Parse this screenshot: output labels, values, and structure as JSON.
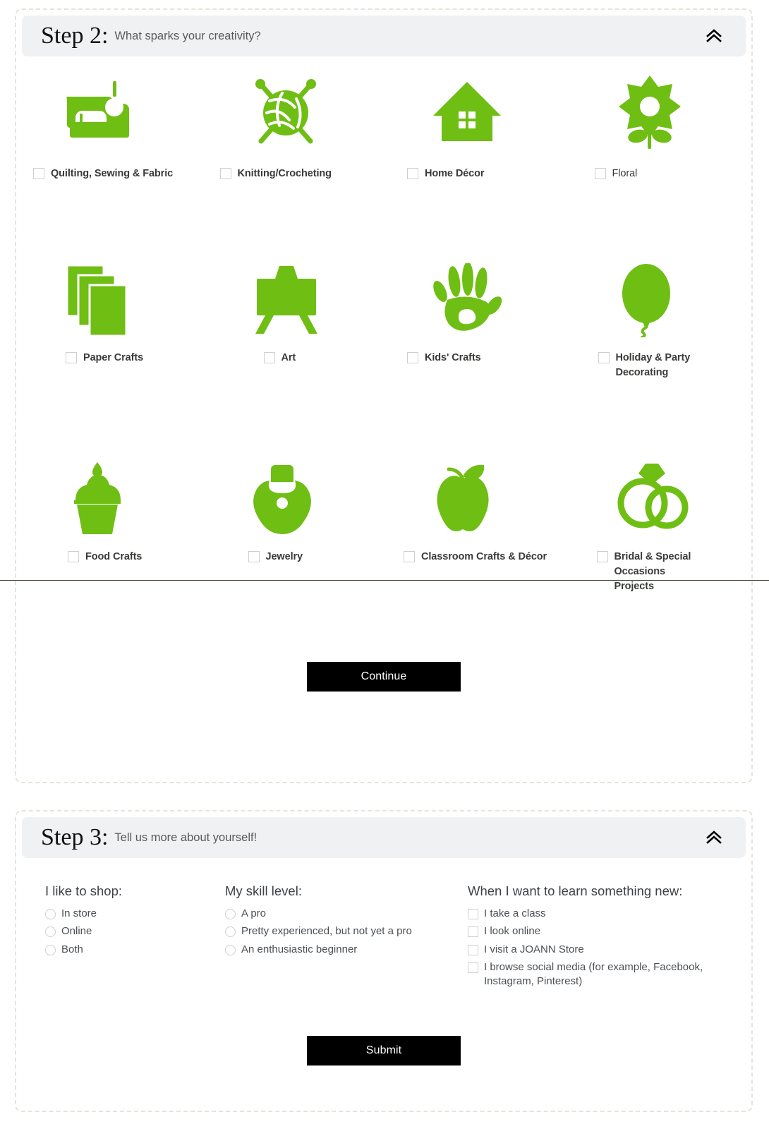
{
  "theme": {
    "icon_green": "#6FBE13",
    "header_bg": "#F0F1F2",
    "panel_border": "#E8E3D9",
    "button_bg": "#000000",
    "button_text": "#FFFFFF",
    "label_color": "#3A3A38",
    "seam_color": "#3F4F38"
  },
  "step2": {
    "title": "Step 2:",
    "subtitle": "What sparks your creativity?",
    "collapse_icon": "double-chevron-up-icon",
    "continue_label": "Continue",
    "interests": [
      {
        "label": "Quilting, Sewing & Fabric",
        "icon": "sewing-machine-icon",
        "checked": false,
        "bold": true
      },
      {
        "label": "Knitting/Crocheting",
        "icon": "yarn-ball-icon",
        "checked": false,
        "bold": true
      },
      {
        "label": "Home Décor",
        "icon": "house-icon",
        "checked": false,
        "bold": true
      },
      {
        "label": "Floral",
        "icon": "flower-icon",
        "checked": false,
        "bold": false
      },
      {
        "label": "Paper Crafts",
        "icon": "stacked-paper-icon",
        "checked": false,
        "bold": true
      },
      {
        "label": "Art",
        "icon": "easel-icon",
        "checked": false,
        "bold": true
      },
      {
        "label": "Kids' Crafts",
        "icon": "handprint-icon",
        "checked": false,
        "bold": true
      },
      {
        "label": "Holiday & Party Decorating",
        "icon": "balloon-icon",
        "checked": false,
        "bold": true
      },
      {
        "label": "Food Crafts",
        "icon": "cupcake-icon",
        "checked": false,
        "bold": true
      },
      {
        "label": "Jewelry",
        "icon": "necklace-icon",
        "checked": false,
        "bold": true
      },
      {
        "label": "Classroom Crafts & Décor",
        "icon": "apple-icon",
        "checked": false,
        "bold": true
      },
      {
        "label": "Bridal & Special Occasions Projects",
        "icon": "wedding-rings-icon",
        "checked": false,
        "bold": true
      }
    ]
  },
  "step3": {
    "title": "Step 3:",
    "subtitle": "Tell us more about yourself!",
    "collapse_icon": "double-chevron-up-icon",
    "submit_label": "Submit",
    "columns": [
      {
        "heading": "I like to shop:",
        "input_type": "radio",
        "options": [
          {
            "label": "In store",
            "selected": false
          },
          {
            "label": "Online",
            "selected": false
          },
          {
            "label": "Both",
            "selected": false
          }
        ]
      },
      {
        "heading": "My skill level:",
        "input_type": "radio",
        "options": [
          {
            "label": "A pro",
            "selected": false
          },
          {
            "label": "Pretty experienced, but not yet a pro",
            "selected": false
          },
          {
            "label": "An enthusiastic beginner",
            "selected": false
          }
        ]
      },
      {
        "heading": "When I want to learn something new:",
        "input_type": "checkbox",
        "options": [
          {
            "label": "I take a class",
            "selected": false
          },
          {
            "label": "I look online",
            "selected": false
          },
          {
            "label": "I visit a JOANN Store",
            "selected": false
          },
          {
            "label": "I browse social media (for example, Facebook, Instagram, Pinterest)",
            "selected": false
          }
        ]
      }
    ]
  }
}
